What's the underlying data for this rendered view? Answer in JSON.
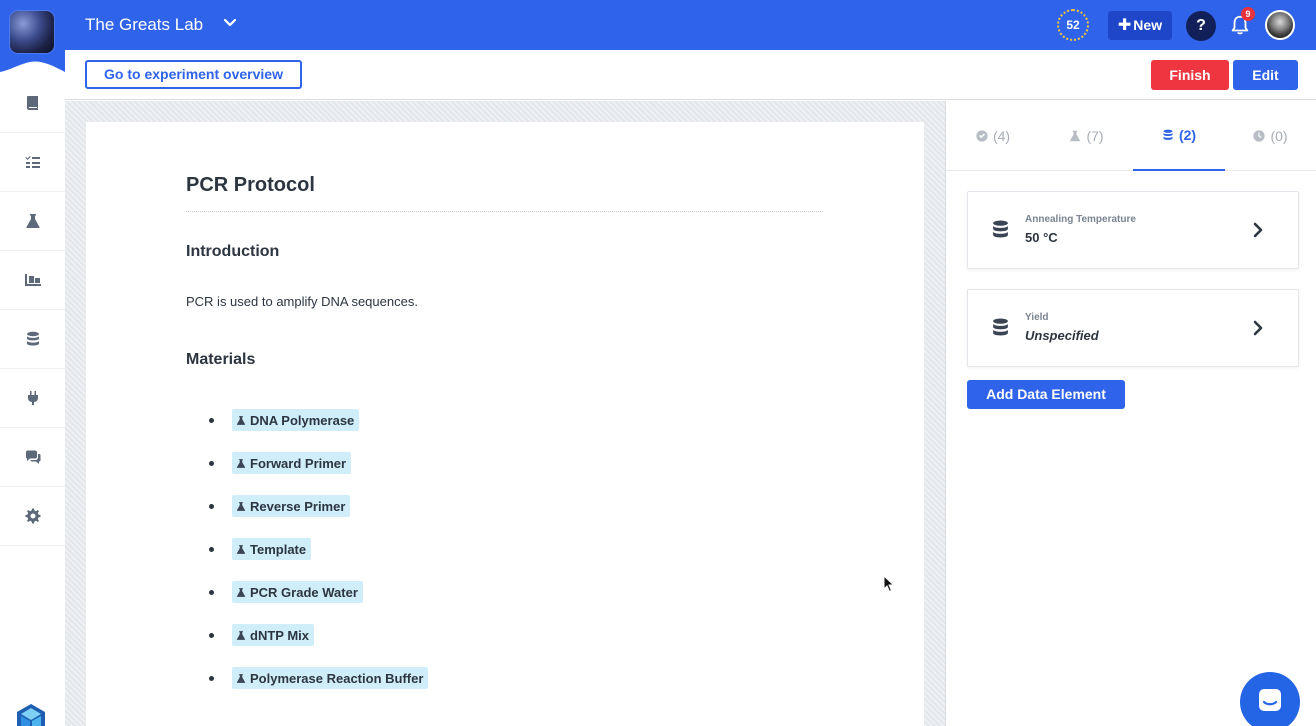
{
  "header": {
    "lab_name": "The Greats Lab",
    "counter": "52",
    "new_label": "New",
    "help_label": "?",
    "notification_count": "9"
  },
  "toolbar": {
    "overview_label": "Go to experiment overview",
    "finish_label": "Finish",
    "edit_label": "Edit"
  },
  "sidebar": {
    "items": [
      {
        "icon": "book-icon"
      },
      {
        "icon": "checklist-icon"
      },
      {
        "icon": "flask-icon"
      },
      {
        "icon": "inventory-icon"
      },
      {
        "icon": "database-icon"
      },
      {
        "icon": "plug-icon"
      },
      {
        "icon": "chat-icon"
      },
      {
        "icon": "gear-icon"
      }
    ]
  },
  "document": {
    "title": "PCR Protocol",
    "intro_heading": "Introduction",
    "intro_text": "PCR is used to amplify DNA sequences.",
    "materials_heading": "Materials",
    "materials": [
      "DNA Polymerase",
      "Forward Primer",
      "Reverse Primer",
      "Template",
      "PCR Grade Water",
      "dNTP Mix",
      "Polymerase Reaction Buffer"
    ]
  },
  "panel": {
    "tabs": [
      {
        "icon": "check-circle-icon",
        "label": "(4)"
      },
      {
        "icon": "flask-icon",
        "label": "(7)"
      },
      {
        "icon": "database-icon",
        "label": "(2)"
      },
      {
        "icon": "clock-icon",
        "label": "(0)"
      }
    ],
    "active_tab": 2,
    "data_elements": [
      {
        "label": "Annealing Temperature",
        "value": "50 °C"
      },
      {
        "label": "Yield",
        "value": "Unspecified"
      }
    ],
    "add_label": "Add Data Element"
  },
  "colors": {
    "brand": "#2e63ea",
    "danger": "#ee3540",
    "chip": "#cfeefa"
  }
}
